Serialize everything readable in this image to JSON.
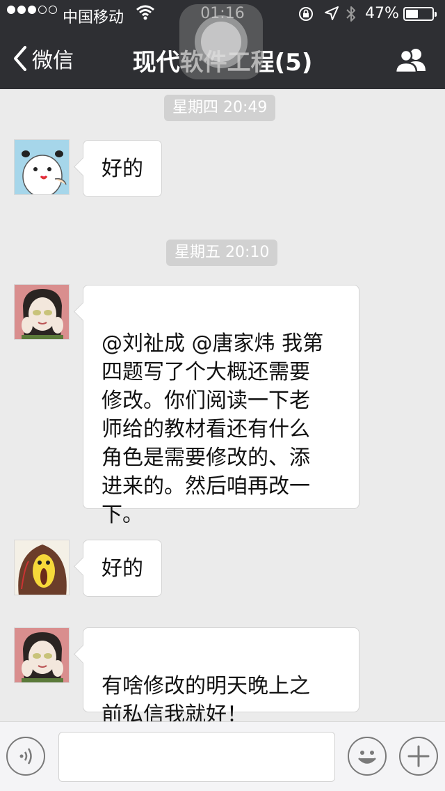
{
  "status_bar": {
    "carrier": "中国移动",
    "time": "01:16",
    "battery": "47%",
    "battery_level": 0.47,
    "signal_filled": 3,
    "signal_total": 5
  },
  "nav": {
    "back_label": "微信",
    "title": "现代软件工程(5)"
  },
  "chat": {
    "timestamps": [
      "星期四 20:49",
      "星期五 20:10"
    ],
    "messages": [
      {
        "text": "好的"
      },
      {
        "text": "@刘祉成 @唐家炜 我第\n四题写了个大概还需要\n修改。你们阅读一下老\n师给的教材看还有什么\n角色是需要修改的、添\n进来的。然后咱再改一\n下。"
      },
      {
        "text": "好的"
      },
      {
        "text": "有啥修改的明天晚上之\n前私信我就好！"
      }
    ]
  },
  "input_bar": {
    "message_value": ""
  },
  "colors": {
    "nav_bg": "#2e2f33",
    "chat_bg": "#ebebeb",
    "bubble_bg": "#ffffff",
    "timestamp_bg": "#d1d1d1"
  },
  "icons": [
    "back-chevron-icon",
    "group-members-icon",
    "voice-icon",
    "emoji-icon",
    "plus-icon",
    "wifi-icon",
    "rotation-lock-icon",
    "location-icon",
    "bluetooth-icon"
  ]
}
